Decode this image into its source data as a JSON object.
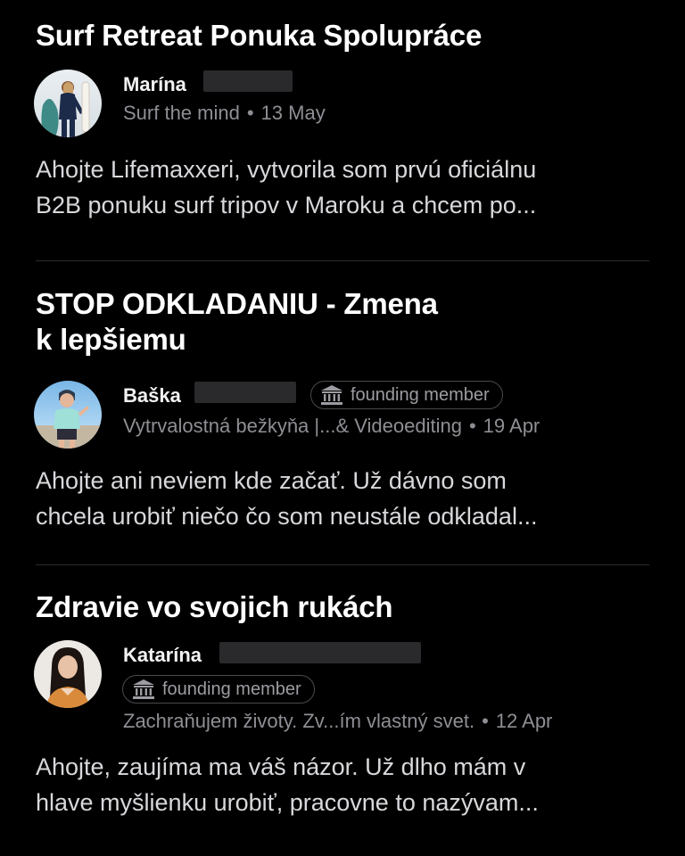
{
  "posts": [
    {
      "title": "Surf Retreat Ponuka Spolupráce",
      "author": "Marína",
      "badge": "",
      "subtitle": "Surf the mind",
      "date": "13 May",
      "excerpt_lines": [
        "Ahojte Lifemaxxeri, vytvorila som prvú oficiálnu",
        "B2B ponuku surf tripov v Maroku a chcem po..."
      ]
    },
    {
      "title_lines": [
        "STOP ODKLADANIU - Zmena",
        "k lepšiemu"
      ],
      "author": "Baška",
      "badge": "founding member",
      "subtitle": "Vytrvalostná bežkyňa |...& Videoediting",
      "date": "19 Apr",
      "excerpt_lines": [
        "Ahojte ani neviem kde začať. Už dávno som",
        "chcela urobiť niečo čo som neustále odkladal..."
      ]
    },
    {
      "title": "Zdravie vo svojich rukách",
      "author": "Katarína",
      "badge": "founding member",
      "subtitle": "Zachraňujem životy. Zv...ím vlastný svet.",
      "date": "12 Apr",
      "excerpt_lines": [
        "Ahojte, zaujíma ma váš názor. Už dlho mám v",
        "hlave myšlienku urobiť, pracovne to nazývam..."
      ]
    }
  ],
  "separator": "•",
  "colors": {
    "background": "#000000",
    "title": "#ffffff",
    "secondary_text": "#8e8e94",
    "body_text": "#d8d8dc",
    "divider": "#2c2c2e",
    "badge_border": "#4a4a4e"
  },
  "icons": {
    "badge": "columns-building-icon"
  }
}
